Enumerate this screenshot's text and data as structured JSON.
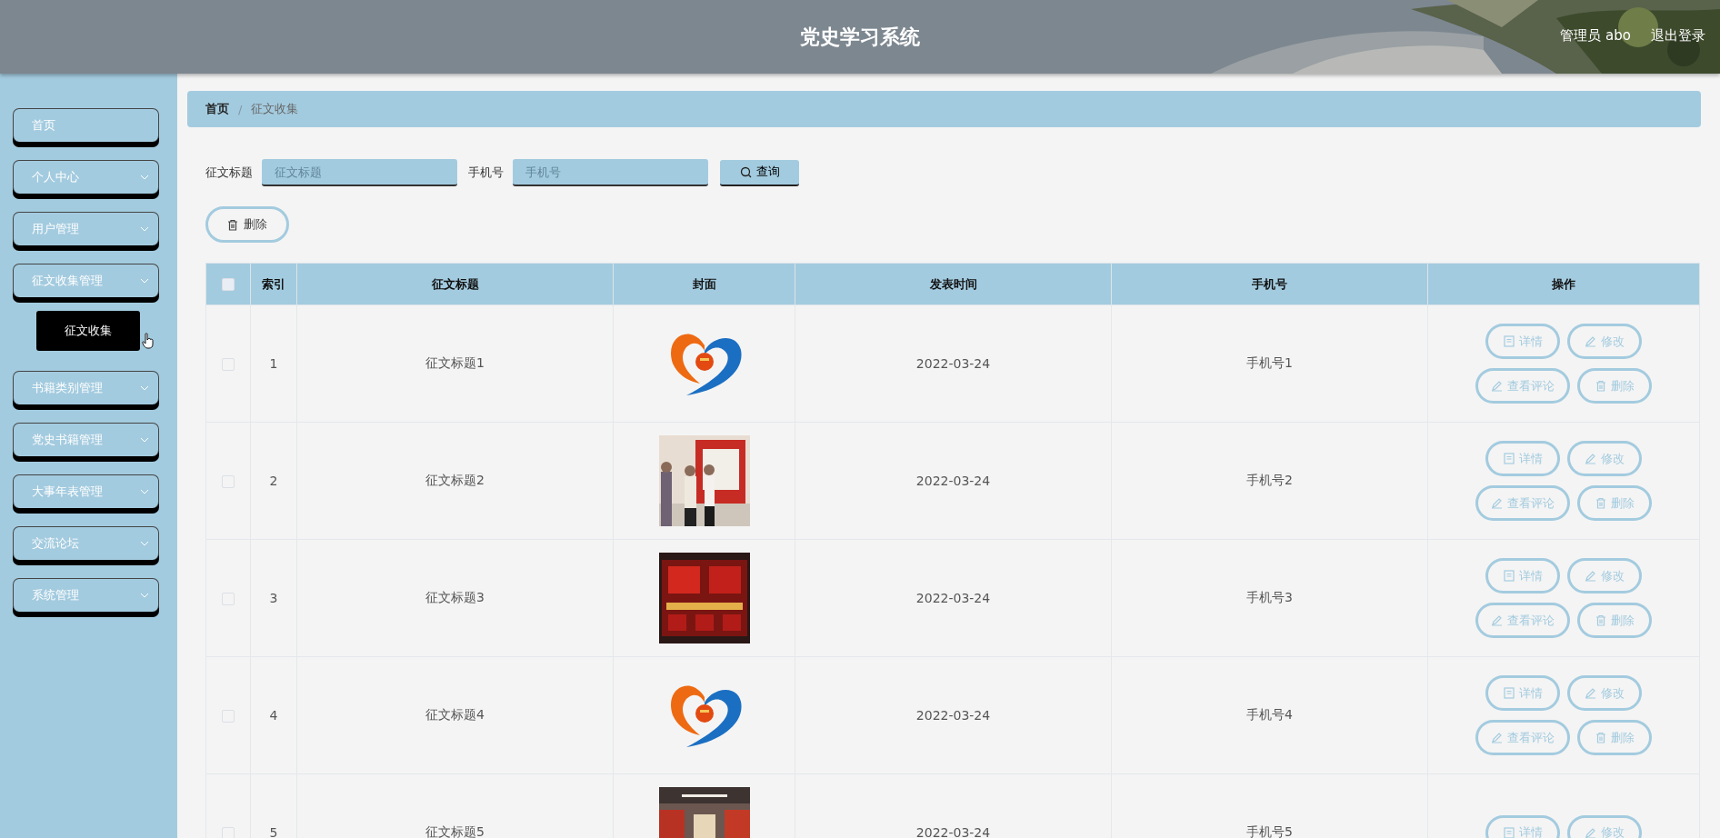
{
  "header": {
    "title": "党史学习系统",
    "user": "管理员 abo",
    "logout": "退出登录"
  },
  "sidebar": {
    "items": [
      {
        "label": "首页",
        "kind": "link"
      },
      {
        "label": "个人中心",
        "kind": "menu"
      },
      {
        "label": "用户管理",
        "kind": "menu"
      },
      {
        "label": "征文收集管理",
        "kind": "menu",
        "children": [
          {
            "label": "征文收集",
            "selected": true
          }
        ]
      },
      {
        "label": "书籍类别管理",
        "kind": "menu"
      },
      {
        "label": "党史书籍管理",
        "kind": "menu"
      },
      {
        "label": "大事年表管理",
        "kind": "menu"
      },
      {
        "label": "交流论坛",
        "kind": "menu"
      },
      {
        "label": "系统管理",
        "kind": "menu"
      }
    ]
  },
  "breadcrumb": {
    "items": [
      "首页",
      "征文收集"
    ],
    "separator": "/"
  },
  "search": {
    "fields": [
      {
        "label": "征文标题",
        "placeholder": "征文标题"
      },
      {
        "label": "手机号",
        "placeholder": "手机号"
      }
    ],
    "button": "查询"
  },
  "delete_button": "删除",
  "table": {
    "columns": [
      "索引",
      "征文标题",
      "封面",
      "发表时间",
      "手机号",
      "操作"
    ],
    "all_checked": false,
    "rows": [
      {
        "checked": false,
        "index": "1",
        "title": "征文标题1",
        "cover": {
          "kind": "picture"
        },
        "time": "2022-03-24",
        "phone": "手机号1",
        "actions": [
          {
            "label": "详情",
            "kind": "detail"
          },
          {
            "label": "修改",
            "kind": "edit"
          },
          {
            "label": "查看评论",
            "kind": "edit"
          },
          {
            "label": "删除",
            "kind": "delete"
          }
        ]
      },
      {
        "checked": false,
        "index": "2",
        "title": "征文标题2",
        "cover": {
          "kind": "picture"
        },
        "time": "2022-03-24",
        "phone": "手机号2",
        "actions": [
          {
            "label": "详情",
            "kind": "detail"
          },
          {
            "label": "修改",
            "kind": "edit"
          },
          {
            "label": "查看评论",
            "kind": "edit"
          },
          {
            "label": "删除",
            "kind": "delete"
          }
        ]
      },
      {
        "checked": false,
        "index": "3",
        "title": "征文标题3",
        "cover": {
          "kind": "picture"
        },
        "time": "2022-03-24",
        "phone": "手机号3",
        "actions": [
          {
            "label": "详情",
            "kind": "detail"
          },
          {
            "label": "修改",
            "kind": "edit"
          },
          {
            "label": "查看评论",
            "kind": "edit"
          },
          {
            "label": "删除",
            "kind": "delete"
          }
        ]
      },
      {
        "checked": false,
        "index": "4",
        "title": "征文标题4",
        "cover": {
          "kind": "picture"
        },
        "time": "2022-03-24",
        "phone": "手机号4",
        "actions": [
          {
            "label": "详情",
            "kind": "detail"
          },
          {
            "label": "修改",
            "kind": "edit"
          },
          {
            "label": "查看评论",
            "kind": "edit"
          },
          {
            "label": "删除",
            "kind": "delete"
          }
        ]
      },
      {
        "checked": false,
        "index": "5",
        "title": "征文标题5",
        "cover": {
          "kind": "picture"
        },
        "time": "2022-03-24",
        "phone": "手机号5",
        "actions": [
          {
            "label": "详情",
            "kind": "detail"
          },
          {
            "label": "修改",
            "kind": "edit"
          }
        ]
      }
    ]
  }
}
